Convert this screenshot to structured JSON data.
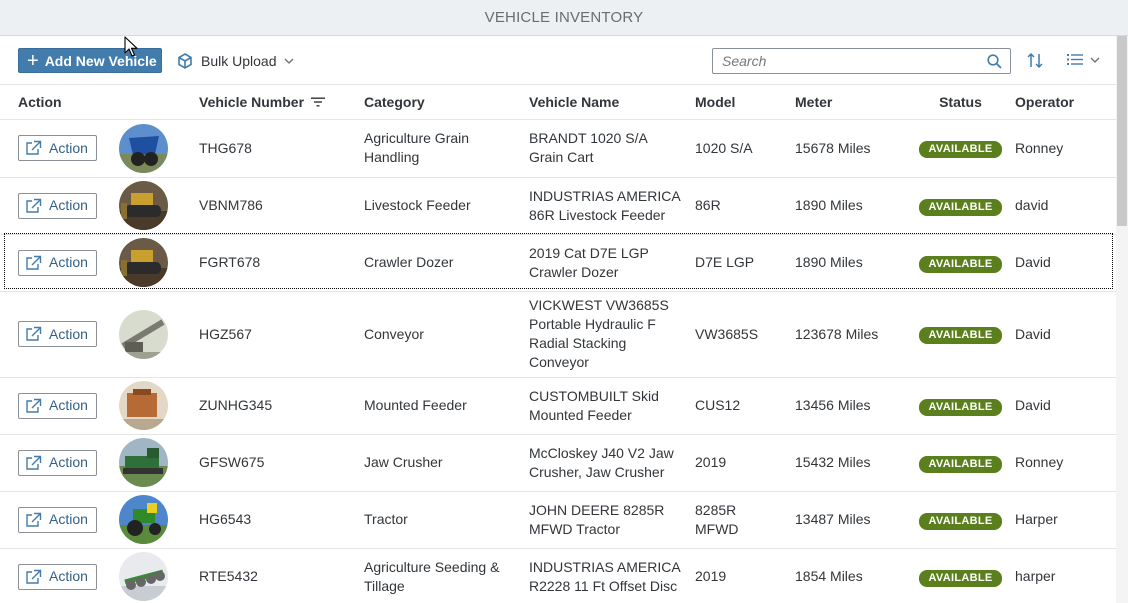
{
  "page_title": "VEHICLE INVENTORY",
  "toolbar": {
    "add_label": "Add New Vehicle",
    "bulk_label": "Bulk Upload",
    "search_placeholder": "Search"
  },
  "colors": {
    "primary_button": "#427cac",
    "status_available": "#5a7f1c",
    "link_text": "#346187"
  },
  "table": {
    "headers": {
      "action": "Action",
      "vehicle_number": "Vehicle Number",
      "category": "Category",
      "vehicle_name": "Vehicle Name",
      "model": "Model",
      "meter": "Meter",
      "status": "Status",
      "operator": "Operator"
    },
    "rows": [
      {
        "action": "Action",
        "number": "THG678",
        "category": [
          "Agriculture Grain",
          "Handling"
        ],
        "name": [
          "BRANDT 1020 S/A",
          "Grain Cart"
        ],
        "model": [
          "1020 S/A"
        ],
        "meter": "15678 Miles",
        "status": "AVAILABLE",
        "operator": "Ronney",
        "img": "grain-cart"
      },
      {
        "action": "Action",
        "number": "VBNM786",
        "category": [
          "Livestock Feeder"
        ],
        "name": [
          "INDUSTRIAS AMERICA",
          "86R Livestock Feeder"
        ],
        "model": [
          "86R"
        ],
        "meter": "1890 Miles",
        "status": "AVAILABLE",
        "operator": "david",
        "img": "dozer"
      },
      {
        "action": "Action",
        "number": "FGRT678",
        "category": [
          "Crawler Dozer"
        ],
        "name": [
          "2019 Cat D7E LGP",
          "Crawler Dozer"
        ],
        "model": [
          "D7E LGP"
        ],
        "meter": "1890 Miles",
        "status": "AVAILABLE",
        "operator": "David",
        "img": "dozer"
      },
      {
        "action": "Action",
        "number": "HGZ567",
        "category": [
          "Conveyor"
        ],
        "name": [
          "VICKWEST VW3685S",
          "Portable Hydraulic F",
          "Radial Stacking",
          "Conveyor"
        ],
        "model": [
          "VW3685S"
        ],
        "meter": "123678 Miles",
        "status": "AVAILABLE",
        "operator": "David",
        "img": "conveyor"
      },
      {
        "action": "Action",
        "number": "ZUNHG345",
        "category": [
          "Mounted Feeder"
        ],
        "name": [
          "CUSTOMBUILT Skid",
          "Mounted Feeder"
        ],
        "model": [
          "CUS12"
        ],
        "meter": "13456 Miles",
        "status": "AVAILABLE",
        "operator": "David",
        "img": "feeder"
      },
      {
        "action": "Action",
        "number": "GFSW675",
        "category": [
          "Jaw Crusher"
        ],
        "name": [
          "McCloskey J40 V2 Jaw",
          "Crusher, Jaw Crusher"
        ],
        "model": [
          "2019"
        ],
        "meter": "15432 Miles",
        "status": "AVAILABLE",
        "operator": "Ronney",
        "img": "crusher"
      },
      {
        "action": "Action",
        "number": "HG6543",
        "category": [
          "Tractor"
        ],
        "name": [
          "JOHN DEERE 8285R",
          "MFWD Tractor"
        ],
        "model": [
          "8285R",
          "MFWD"
        ],
        "meter": "13487 Miles",
        "status": "AVAILABLE",
        "operator": "Harper",
        "img": "tractor"
      },
      {
        "action": "Action",
        "number": "RTE5432",
        "category": [
          "Agriculture Seeding &",
          "Tillage"
        ],
        "name": [
          "INDUSTRIAS AMERICA",
          "R2228 11 Ft Offset Disc"
        ],
        "model": [
          "2019"
        ],
        "meter": "1854 Miles",
        "status": "AVAILABLE",
        "operator": "harper",
        "img": "disc"
      }
    ]
  }
}
